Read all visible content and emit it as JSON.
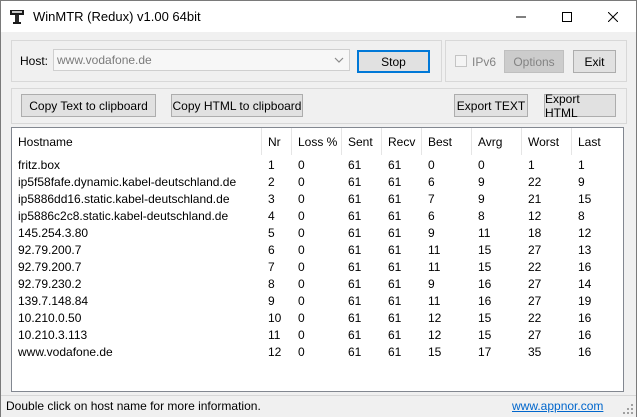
{
  "window": {
    "title": "WinMTR (Redux) v1.00 64bit"
  },
  "host": {
    "label": "Host:",
    "value": "www.vodafone.de"
  },
  "buttons": {
    "stop": "Stop",
    "options": "Options",
    "exit": "Exit",
    "copy_text": "Copy Text to clipboard",
    "copy_html": "Copy HTML to clipboard",
    "export_text": "Export TEXT",
    "export_html": "Export HTML"
  },
  "ipv6": {
    "label": "IPv6",
    "checked": false
  },
  "table": {
    "columns": [
      "Hostname",
      "Nr",
      "Loss %",
      "Sent",
      "Recv",
      "Best",
      "Avrg",
      "Worst",
      "Last"
    ],
    "rows": [
      [
        "fritz.box",
        "1",
        "0",
        "61",
        "61",
        "0",
        "0",
        "1",
        "1"
      ],
      [
        "ip5f58fafe.dynamic.kabel-deutschland.de",
        "2",
        "0",
        "61",
        "61",
        "6",
        "9",
        "22",
        "9"
      ],
      [
        "ip5886dd16.static.kabel-deutschland.de",
        "3",
        "0",
        "61",
        "61",
        "7",
        "9",
        "21",
        "15"
      ],
      [
        "ip5886c2c8.static.kabel-deutschland.de",
        "4",
        "0",
        "61",
        "61",
        "6",
        "8",
        "12",
        "8"
      ],
      [
        "145.254.3.80",
        "5",
        "0",
        "61",
        "61",
        "9",
        "11",
        "18",
        "12"
      ],
      [
        "92.79.200.7",
        "6",
        "0",
        "61",
        "61",
        "11",
        "15",
        "27",
        "13"
      ],
      [
        "92.79.200.7",
        "7",
        "0",
        "61",
        "61",
        "11",
        "15",
        "22",
        "16"
      ],
      [
        "92.79.230.2",
        "8",
        "0",
        "61",
        "61",
        "9",
        "16",
        "27",
        "14"
      ],
      [
        "139.7.148.84",
        "9",
        "0",
        "61",
        "61",
        "11",
        "16",
        "27",
        "19"
      ],
      [
        "10.210.0.50",
        "10",
        "0",
        "61",
        "61",
        "12",
        "15",
        "22",
        "16"
      ],
      [
        "10.210.3.113",
        "11",
        "0",
        "61",
        "61",
        "12",
        "15",
        "27",
        "16"
      ],
      [
        "www.vodafone.de",
        "12",
        "0",
        "61",
        "61",
        "15",
        "17",
        "35",
        "16"
      ]
    ]
  },
  "status": {
    "message": "Double click on host name for more information.",
    "link": "www.appnor.com"
  },
  "colors": {
    "link": "#0066cc",
    "focus_border": "#0078d7"
  }
}
